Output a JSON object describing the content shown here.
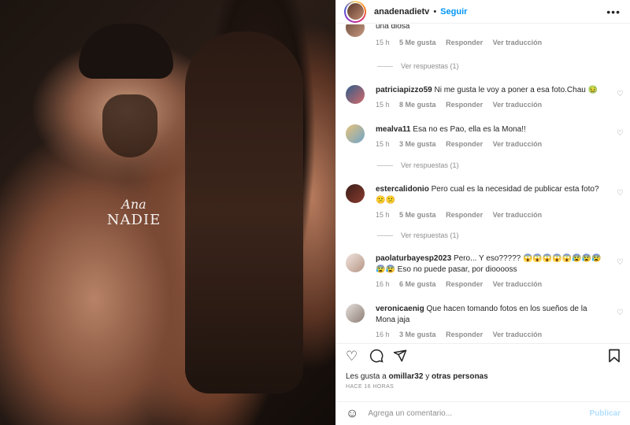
{
  "post": {
    "username": "anadenadietv",
    "separator": "•",
    "follow_label": "Seguir",
    "more_icon": "more-options-icon",
    "watermark_line1": "Ana",
    "watermark_line2": "NADIE"
  },
  "comments": [
    {
      "user": "",
      "text": "una diosa",
      "time": "15 h",
      "likes": "5 Me gusta",
      "reply": "Responder",
      "translate": "Ver traducción",
      "replies_label": "Ver respuestas (1)"
    },
    {
      "user": "patriciapizzo59",
      "text": "Ni me gusta le voy a poner a esa foto.Chau 🤢",
      "time": "15 h",
      "likes": "8 Me gusta",
      "reply": "Responder",
      "translate": "Ver traducción"
    },
    {
      "user": "mealva11",
      "text": "Esa no es Pao, ella es la Mona!!",
      "time": "15 h",
      "likes": "3 Me gusta",
      "reply": "Responder",
      "translate": "Ver traducción",
      "replies_label": "Ver respuestas (1)"
    },
    {
      "user": "estercalidonio",
      "text": "Pero cual es la necesidad de publicar esta foto? 😕😕",
      "time": "15 h",
      "likes": "5 Me gusta",
      "reply": "Responder",
      "translate": "Ver traducción",
      "replies_label": "Ver respuestas (1)"
    },
    {
      "user": "paolaturbayesp2023",
      "text": "Pero... Y eso????? 😱😱😱😱😱😰😰😰😰😰 Eso no puede pasar, por diooooss",
      "time": "16 h",
      "likes": "6 Me gusta",
      "reply": "Responder",
      "translate": "Ver traducción"
    },
    {
      "user": "veronicaenig",
      "text": "Que hacen tomando fotos en los sueños de la Mona jaja",
      "time": "16 h",
      "likes": "3 Me gusta",
      "reply": "Responder",
      "translate": "Ver traducción"
    }
  ],
  "footer": {
    "likes_prefix": "Les gusta a",
    "likes_user": "omillar32",
    "likes_middle": "y",
    "likes_others": "otras personas",
    "time_ago": "HACE 16 HORAS",
    "comment_placeholder": "Agrega un comentario...",
    "post_label": "Publicar"
  },
  "colors": {
    "accent": "#0095f6",
    "publish_disabled": "#b2dffc",
    "muted": "#8e8e8e"
  }
}
